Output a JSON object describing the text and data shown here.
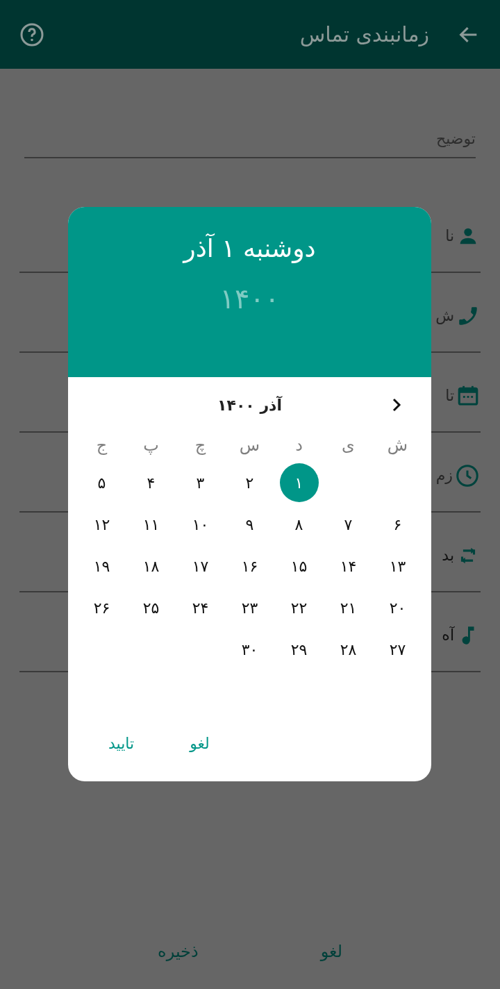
{
  "app_bar": {
    "title": "زمانبندی تماس"
  },
  "description_field": {
    "placeholder": "توضیح"
  },
  "fields": [
    {
      "label": "نا"
    },
    {
      "label": "ش"
    },
    {
      "label": "تا"
    },
    {
      "label": "زم"
    },
    {
      "label": "بد"
    },
    {
      "label": "آه"
    }
  ],
  "bottom_buttons": [
    "لغو",
    "ذخیره"
  ],
  "date_picker": {
    "selected_date": "دوشنبه ۱ آذر",
    "year": "۱۴۰۰",
    "month": "آذر ۱۴۰۰",
    "weekdays": [
      "ش",
      "ی",
      "د",
      "س",
      "چ",
      "پ",
      "ج"
    ],
    "weeks": [
      [
        {
          "label": "۱",
          "selected": true
        },
        {
          "label": "۲",
          "selected": false
        },
        {
          "label": "۳",
          "selected": false
        },
        {
          "label": "۴",
          "selected": false
        },
        {
          "label": "۵",
          "selected": false
        }
      ],
      [
        {
          "label": "۶",
          "selected": false
        },
        {
          "label": "۷",
          "selected": false
        },
        {
          "label": "۸",
          "selected": false
        },
        {
          "label": "۹",
          "selected": false
        },
        {
          "label": "۱۰",
          "selected": false
        },
        {
          "label": "۱۱",
          "selected": false
        },
        {
          "label": "۱۲",
          "selected": false
        }
      ],
      [
        {
          "label": "۱۳",
          "selected": false
        },
        {
          "label": "۱۴",
          "selected": false
        },
        {
          "label": "۱۵",
          "selected": false
        },
        {
          "label": "۱۶",
          "selected": false
        },
        {
          "label": "۱۷",
          "selected": false
        },
        {
          "label": "۱۸",
          "selected": false
        },
        {
          "label": "۱۹",
          "selected": false
        }
      ],
      [
        {
          "label": "۲۰",
          "selected": false
        },
        {
          "label": "۲۱",
          "selected": false
        },
        {
          "label": "۲۲",
          "selected": false
        },
        {
          "label": "۲۳",
          "selected": false
        },
        {
          "label": "۲۴",
          "selected": false
        },
        {
          "label": "۲۵",
          "selected": false
        },
        {
          "label": "۲۶",
          "selected": false
        }
      ],
      [
        {
          "label": "۲۷",
          "selected": false
        },
        {
          "label": "۲۸",
          "selected": false
        },
        {
          "label": "۲۹",
          "selected": false
        },
        {
          "label": "۳۰",
          "selected": false
        }
      ]
    ],
    "buttons": [
      "لغو",
      "تایید"
    ]
  }
}
